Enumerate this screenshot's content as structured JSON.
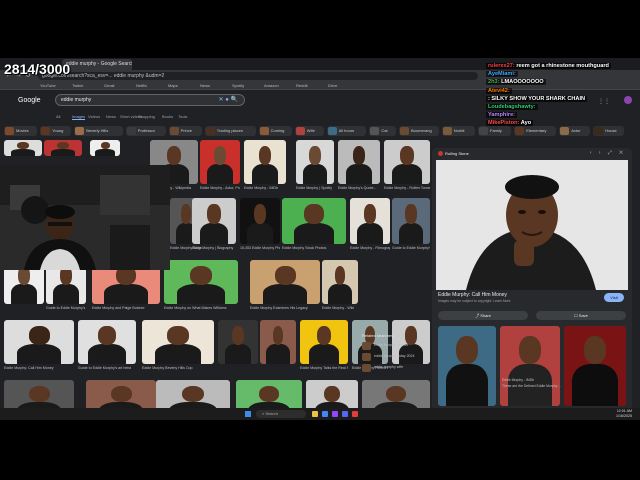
{
  "overlay": {
    "counter": "2814/3000",
    "chat": [
      {
        "user": "rulerxx27:",
        "message": "reem got a rhinestone mouthguard",
        "color": "#ff4040"
      },
      {
        "user": "AyeMiami:",
        "message": "",
        "color": "#3fa9ff"
      },
      {
        "user": "2h3:",
        "message": "LMAOOOOOOO",
        "color": "#4caf50"
      },
      {
        "user": "Atevi42:",
        "message": "",
        "color": "#ff7b00"
      },
      {
        "user": "",
        "message": ": SILKY SHOW YOUR SHARK CHAIN",
        "color": "#ffffff"
      },
      {
        "user": "Loudebagshawty:",
        "message": "",
        "color": "#2ecc71"
      },
      {
        "user": "Yamphire:",
        "message": "",
        "color": "#bb86fc"
      },
      {
        "user": "MikePiston:",
        "message": "Ayo",
        "color": "#ff4d4d"
      }
    ]
  },
  "browser": {
    "tab_title": "eddie murphy - Google Search",
    "url": "google.com/search?sca_esv=... eddie murphy &udm=2",
    "bookmarks": [
      "YouTube",
      "Twitch",
      "Gmail",
      "Netflix",
      "Maps",
      "News",
      "Spotify",
      "Amazon",
      "Reddit",
      "Drive"
    ]
  },
  "google": {
    "logo": "Google",
    "query": "eddie murphy",
    "tabs": [
      "All",
      "Images",
      "Videos",
      "News",
      "Short videos",
      "Shopping",
      "Books",
      "Tools"
    ],
    "active_tab": "Images",
    "chips": [
      "Movies",
      "Young",
      "Beverly Hills",
      "Professor",
      "Prince",
      "Trading places",
      "Coming",
      "Wife",
      "All hours",
      "Cat",
      "Boomerang",
      "Norbit",
      "Family",
      "Elementary",
      "Actor",
      "House",
      "Married",
      "Tower Rebels",
      "The job",
      "Tricks",
      "Dolemite",
      "Saved"
    ]
  },
  "results": {
    "captions": [
      "Eddie Murphy - Wikipedia",
      "Eddie Murphy - Actor, Producer...",
      "Eddie Murphy - IMDb",
      "Eddie Murphy | Spotify",
      "Eddie Murphy's Quote...",
      "Eddie Murphy - Rotten Tomatoes",
      "Eddie Murphy Biography",
      "Eddie Murphy | Biography",
      "15,453 Eddie Murphy Photos & High...",
      "Eddie Murphy Stock Photos",
      "Eddie Murphy - Filmography",
      "Guide to Eddie Murphy's Life",
      "Eddie Murphy and Paige Butcher",
      "Eddie Murphy on What Makes Williams",
      "Eddie Murphy Examines His Legacy",
      "Eddie Murphy - Wiki",
      "Eddie Murphy: Call Him Money",
      "Guide to Eddie Murphy's art heist",
      "Eddie Murphy Beverly Hills Cop",
      "Eddie Murphy Talks the Real Story of...",
      "Eddie Murphy Filmed Beverly Hills Cop"
    ],
    "related_title": "Related searches",
    "related": [
      "eddie murphy partner",
      "eddie murphy today 2024",
      "eddie murphy wife"
    ]
  },
  "preview": {
    "source": "Rolling Stone",
    "title": "Eddie Murphy: Call Him Money",
    "subtitle": "Images may be subject to copyright. Learn More",
    "visit": "Visit",
    "share": "Share",
    "save": "Save",
    "more_caption": "Eddie Murphy - IMDb",
    "more_caption2": "These are the Defined Eddie Murphy ..."
  },
  "taskbar": {
    "search": "Search",
    "time": "12:01 AM",
    "date": "1/16/2025"
  },
  "colors": {
    "bg": "#202124",
    "accent": "#8ab4f8"
  }
}
